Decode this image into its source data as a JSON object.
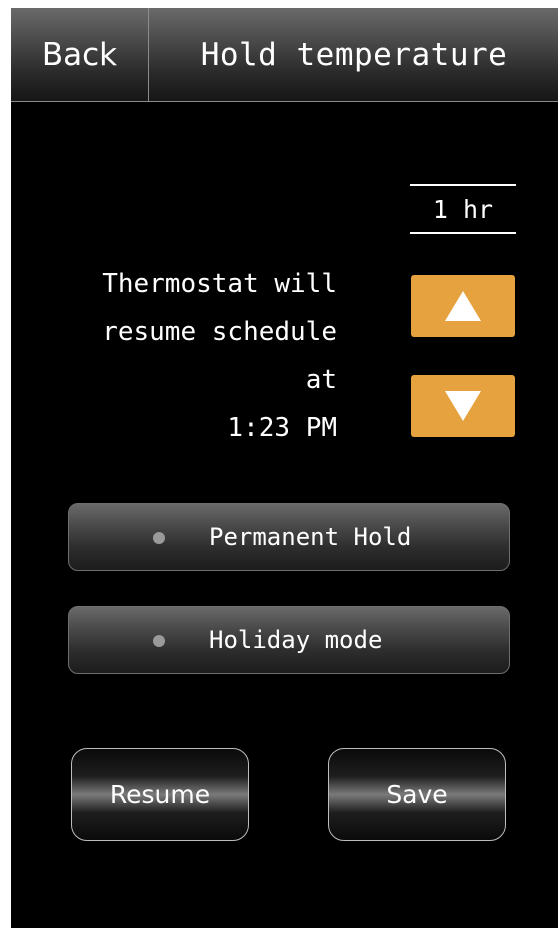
{
  "header": {
    "back_label": "Back",
    "title": "Hold temperature"
  },
  "hold": {
    "duration": "1 hr",
    "increase_icon": "triangle-up-icon",
    "decrease_icon": "triangle-down-icon"
  },
  "message": {
    "line1": "Thermostat will",
    "line2": "resume schedule",
    "line3": "at",
    "time": "1:23 PM"
  },
  "options": [
    {
      "label": "Permanent Hold",
      "selected": false
    },
    {
      "label": "Holiday mode",
      "selected": false
    }
  ],
  "actions": {
    "resume_label": "Resume",
    "save_label": "Save"
  },
  "colors": {
    "accent": "#e6a23e",
    "background": "#000000",
    "text": "#ffffff",
    "indicator": "#9a9a9a"
  }
}
